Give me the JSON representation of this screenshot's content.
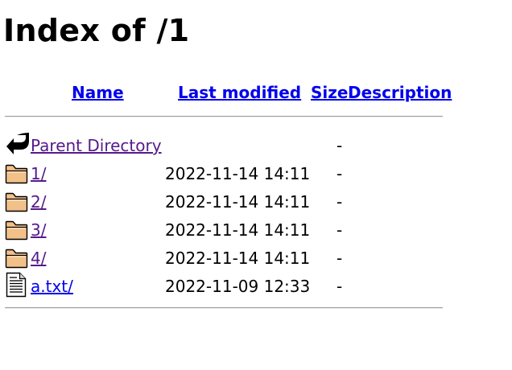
{
  "page": {
    "title": "Index of /1"
  },
  "columns": {
    "name": "Name",
    "last_modified": "Last modified",
    "size": "Size",
    "description": "Description"
  },
  "rows": [
    {
      "name": "Parent Directory",
      "modified": "",
      "size": "-",
      "icon": "back-arrow-icon",
      "visited": true
    },
    {
      "name": "1/",
      "modified": "2022-11-14 14:11",
      "size": "-",
      "icon": "folder-icon",
      "visited": true
    },
    {
      "name": "2/",
      "modified": "2022-11-14 14:11",
      "size": "-",
      "icon": "folder-icon",
      "visited": true
    },
    {
      "name": "3/",
      "modified": "2022-11-14 14:11",
      "size": "-",
      "icon": "folder-icon",
      "visited": true
    },
    {
      "name": "4/",
      "modified": "2022-11-14 14:11",
      "size": "-",
      "icon": "folder-icon",
      "visited": true
    },
    {
      "name": "a.txt/",
      "modified": "2022-11-09 12:33",
      "size": "-",
      "icon": "text-file-icon",
      "visited": false
    }
  ],
  "colors": {
    "link": "#0000ee",
    "visited_link": "#551a8b",
    "folder_fill": "#f2c089",
    "rule": "#9a9a9a"
  }
}
